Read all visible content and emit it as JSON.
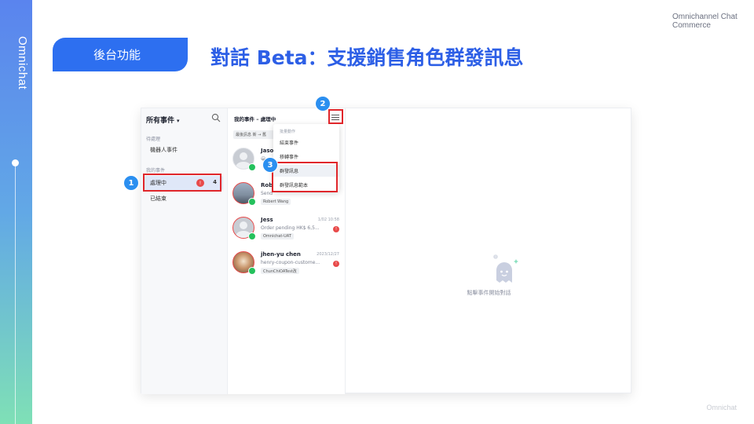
{
  "brand": {
    "logo_text": "Omnichat",
    "corner_text": "Omnichannel Chat\nCommerce",
    "footer_text": "Omnichat"
  },
  "colors": {
    "brand_blue": "#2d6ff0",
    "title_blue": "#2d5fe6",
    "highlight_red": "#e0262b",
    "step_blue": "#2b8ff0"
  },
  "header": {
    "section_label": "後台功能",
    "title": "對話 Beta：支援銷售角色群發訊息"
  },
  "app": {
    "sidebar": {
      "header": "所有事件",
      "groups": [
        {
          "label": "待處理",
          "items": [
            {
              "label": "機器人事件"
            }
          ]
        },
        {
          "label": "我的事件",
          "items": [
            {
              "label": "處理中",
              "badge": "!",
              "count": "4"
            },
            {
              "label": "已結束"
            }
          ]
        }
      ]
    },
    "list": {
      "title": "我的事件 – 處理中",
      "sort_label": "最後訊息 新 → 舊",
      "conversations": [
        {
          "name": "Jaso",
          "message": "😀",
          "time": "",
          "tag": ""
        },
        {
          "name": "Robe",
          "message": "Send",
          "time": "",
          "tag": "Robert Wang"
        },
        {
          "name": "Jess",
          "message": "Order pending HK$ 6,5...",
          "time": "1/02 10:58",
          "tag": "Omnichat-UAT",
          "badge": "!"
        },
        {
          "name": "jhen-yu chen",
          "message": "henry-coupon-custome...",
          "time": "2023/12/27",
          "tag": "ChunChiOATest改",
          "badge": "!"
        }
      ]
    },
    "menu": {
      "header": "批量動作",
      "items": [
        {
          "label": "結束事件"
        },
        {
          "label": "移轉事件"
        },
        {
          "label": "群發訊息"
        },
        {
          "label": "群發訊息範本"
        }
      ]
    },
    "empty_state": {
      "text": "點擊事件開始對話"
    }
  },
  "steps": [
    "1",
    "2",
    "3"
  ]
}
